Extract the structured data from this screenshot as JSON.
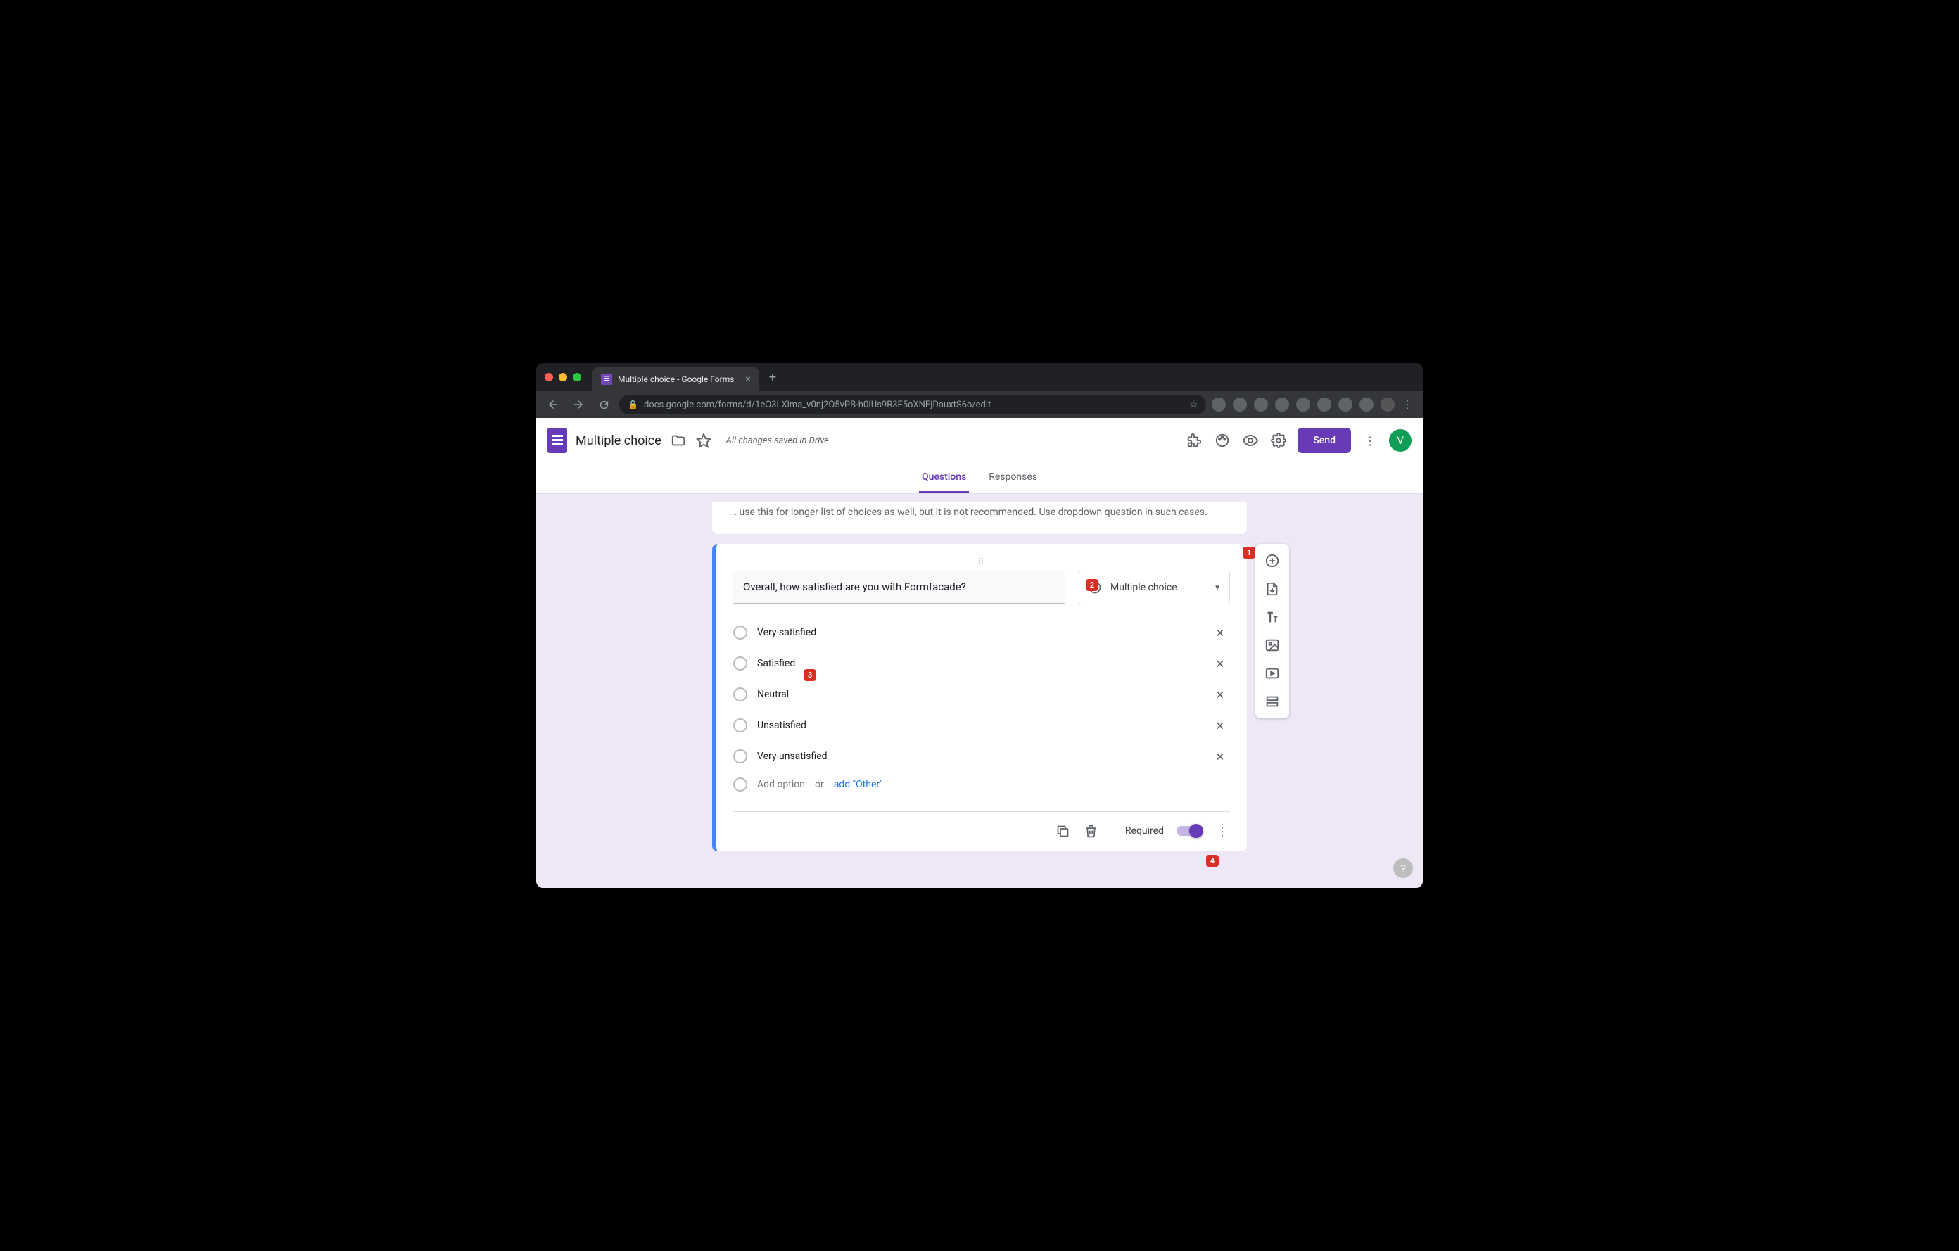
{
  "browser": {
    "tab_title": "Multiple choice - Google Forms",
    "url": "docs.google.com/forms/d/1eO3LXima_v0nj2O5vPB-h0IUs9R3F5oXNEjDauxtS6o/edit"
  },
  "header": {
    "doc_title": "Multiple choice",
    "save_status": "All changes saved in Drive",
    "send_label": "Send",
    "account_initial": "V"
  },
  "tabs": {
    "questions": "Questions",
    "responses": "Responses"
  },
  "info_card": {
    "text_fragment": "... use this for longer list of choices as well, but it is not recommended. Use dropdown question in such cases."
  },
  "question": {
    "title": "Overall, how satisfied are you with Formfacade?",
    "type_label": "Multiple choice",
    "options": [
      "Very satisfied",
      "Satisfied",
      "Neutral",
      "Unsatisfied",
      "Very unsatisfied"
    ],
    "add_option_placeholder": "Add option",
    "add_or": "or",
    "add_other": "add \"Other\"",
    "required_label": "Required"
  },
  "badges": {
    "b1": "1",
    "b2": "2",
    "b3": "3",
    "b4": "4"
  }
}
